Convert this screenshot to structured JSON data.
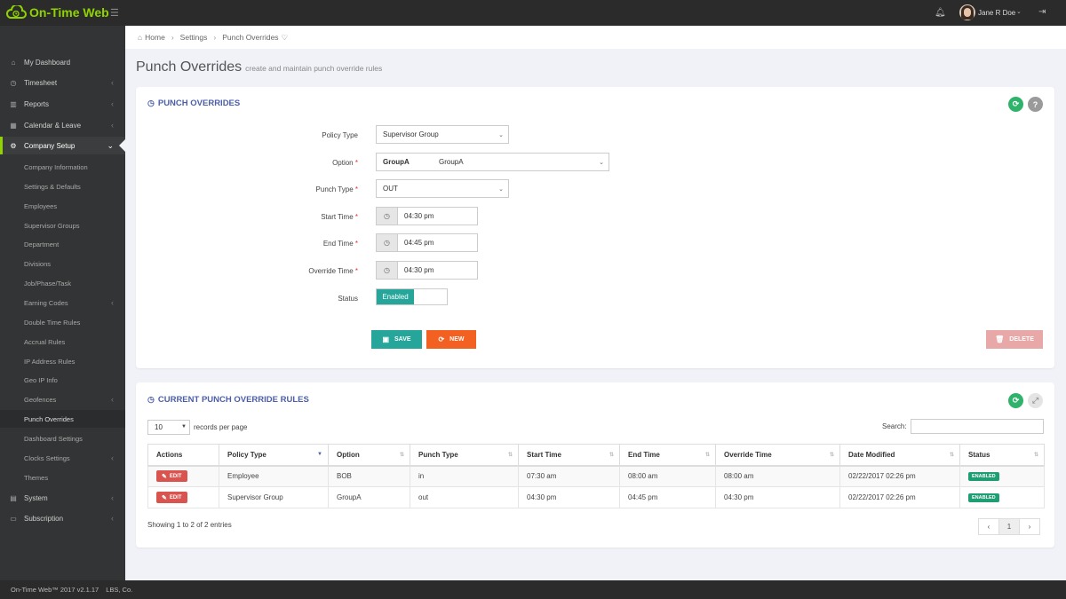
{
  "app": {
    "name": "On-Time Web",
    "user": "Jane R Doe"
  },
  "breadcrumb": [
    "Home",
    "Settings",
    "Punch Overrides"
  ],
  "page": {
    "title": "Punch Overrides",
    "subtitle": "create and maintain punch override rules"
  },
  "sidebar": {
    "items": [
      {
        "label": "My Dashboard"
      },
      {
        "label": "Timesheet"
      },
      {
        "label": "Reports"
      },
      {
        "label": "Calendar & Leave"
      },
      {
        "label": "Company Setup"
      }
    ],
    "sub_items": [
      {
        "label": "Company Information"
      },
      {
        "label": "Settings & Defaults"
      },
      {
        "label": "Employees"
      },
      {
        "label": "Supervisor Groups"
      },
      {
        "label": "Department"
      },
      {
        "label": "Divisions"
      },
      {
        "label": "Job/Phase/Task"
      },
      {
        "label": "Earning Codes"
      },
      {
        "label": "Double Time Rules"
      },
      {
        "label": "Accrual Rules"
      },
      {
        "label": "IP Address Rules"
      },
      {
        "label": "Geo IP Info"
      },
      {
        "label": "Geofences"
      },
      {
        "label": "Punch Overrides"
      },
      {
        "label": "Dashboard Settings"
      },
      {
        "label": "Clocks Settings"
      },
      {
        "label": "Themes"
      }
    ],
    "bottom_items": [
      {
        "label": "System"
      },
      {
        "label": "Subscription"
      }
    ]
  },
  "form_panel": {
    "title": "PUNCH OVERRIDES",
    "help_label": "?",
    "fields": {
      "policy_type": {
        "label": "Policy Type",
        "value": "Supervisor Group"
      },
      "option": {
        "label": "Option",
        "code": "GroupA",
        "name": "GroupA"
      },
      "punch_type": {
        "label": "Punch Type",
        "value": "OUT"
      },
      "start_time": {
        "label": "Start Time",
        "value": "04:30 pm"
      },
      "end_time": {
        "label": "End Time",
        "value": "04:45 pm"
      },
      "override_time": {
        "label": "Override Time",
        "value": "04:30 pm"
      },
      "status": {
        "label": "Status",
        "value": "Enabled"
      }
    },
    "buttons": {
      "save": "SAVE",
      "new": "NEW",
      "delete": "DELETE"
    }
  },
  "table_panel": {
    "title": "CURRENT PUNCH OVERRIDE RULES",
    "page_length": "10",
    "page_length_label": "records per page",
    "search_label": "Search:",
    "columns": [
      "Actions",
      "Policy Type",
      "Option",
      "Punch Type",
      "Start Time",
      "End Time",
      "Override Time",
      "Date Modified",
      "Status"
    ],
    "edit_label": "EDIT",
    "rows": [
      {
        "policy_type": "Employee",
        "option": "BOB",
        "punch_type": "in",
        "start_time": "07:30 am",
        "end_time": "08:00 am",
        "override_time": "08:00 am",
        "date_modified": "02/22/2017 02:26 pm",
        "status": "ENABLED"
      },
      {
        "policy_type": "Supervisor Group",
        "option": "GroupA",
        "punch_type": "out",
        "start_time": "04:30 pm",
        "end_time": "04:45 pm",
        "override_time": "04:30 pm",
        "date_modified": "02/22/2017 02:26 pm",
        "status": "ENABLED"
      }
    ],
    "info": "Showing 1 to 2 of 2 entries",
    "pager": {
      "prev": "‹",
      "current": "1",
      "next": "›"
    }
  },
  "footer": {
    "version": "On-Time Web™ 2017 v2.1.17",
    "company": "LBS, Co."
  },
  "colors": {
    "brand": "#8fd400",
    "panel_title": "#4b5ea8",
    "save": "#26a69a",
    "new": "#f26122",
    "delete": "#e8a8a8",
    "edit": "#d9534f"
  }
}
